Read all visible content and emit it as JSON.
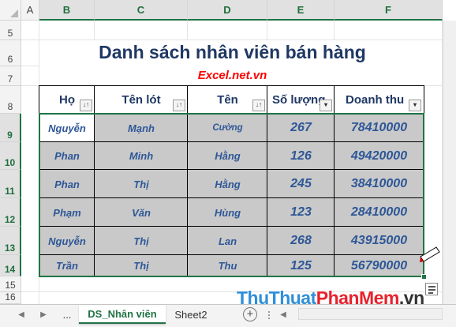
{
  "column_headers": [
    "A",
    "B",
    "C",
    "D",
    "E",
    "F"
  ],
  "row_headers": [
    "5",
    "6",
    "7",
    "8",
    "9",
    "10",
    "11",
    "12",
    "13",
    "14",
    "15",
    "16"
  ],
  "title": "Danh sách nhân viên bán hàng",
  "subtitle": "Excel.net.vn",
  "table": {
    "headers": [
      "Họ",
      "Tên lót",
      "Tên",
      "Số lượng",
      "Doanh thu"
    ],
    "rows": [
      [
        "Nguyễn",
        "Mạnh",
        "Cường",
        "267",
        "78410000"
      ],
      [
        "Phan",
        "Minh",
        "Hằng",
        "126",
        "49420000"
      ],
      [
        "Phan",
        "Thị",
        "Hằng",
        "245",
        "38410000"
      ],
      [
        "Phạm",
        "Văn",
        "Hùng",
        "123",
        "28410000"
      ],
      [
        "Nguyễn",
        "Thị",
        "Lan",
        "268",
        "43915000"
      ],
      [
        "Trần",
        "Thị",
        "Thu",
        "125",
        "56790000"
      ]
    ]
  },
  "sheet_tabs": {
    "ellipsis": "...",
    "active": "DS_Nhân viên",
    "other": "Sheet2",
    "add": "+"
  },
  "watermark": {
    "part1": "ThuThuat",
    "part2": "PhanMem",
    "part3": ".vn"
  },
  "colors": {
    "accent": "#217346",
    "title": "#1f3864",
    "subtitle": "#ff0000",
    "cell_text": "#2e5797",
    "shade": "#c9c9c9"
  }
}
